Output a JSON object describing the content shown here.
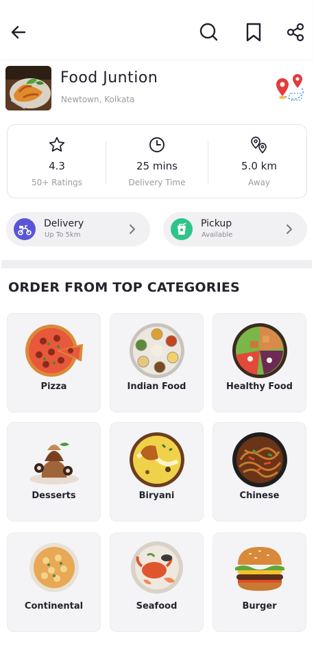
{
  "header": {
    "back_icon": "arrow-left-icon",
    "search_icon": "search-icon",
    "bookmark_icon": "bookmark-icon",
    "share_icon": "share-icon"
  },
  "restaurant": {
    "name": "Food Juntion",
    "location": "Newtown, Kolkata",
    "route_icon": "route-map-pin-icon"
  },
  "stats": [
    {
      "icon": "star-icon",
      "value": "4.3",
      "label": "50+ Ratings"
    },
    {
      "icon": "clock-icon",
      "value": "25 mins",
      "label": "Delivery Time"
    },
    {
      "icon": "location-pins-icon",
      "value": "5.0 km",
      "label": "Away"
    }
  ],
  "options": [
    {
      "title": "Delivery",
      "subtitle": "Up To 5km",
      "icon": "delivery-scooter-icon",
      "color": "#5a55d6"
    },
    {
      "title": "Pickup",
      "subtitle": "Available",
      "icon": "takeaway-cup-icon",
      "color": "#2ec48a"
    }
  ],
  "section_title": "ORDER FROM TOP CATEGORIES",
  "categories": [
    {
      "name": "Pizza"
    },
    {
      "name": "Indian Food"
    },
    {
      "name": "Healthy Food"
    },
    {
      "name": "Desserts"
    },
    {
      "name": "Biryani"
    },
    {
      "name": "Chinese"
    },
    {
      "name": "Continental"
    },
    {
      "name": "Seafood"
    },
    {
      "name": "Burger"
    }
  ]
}
